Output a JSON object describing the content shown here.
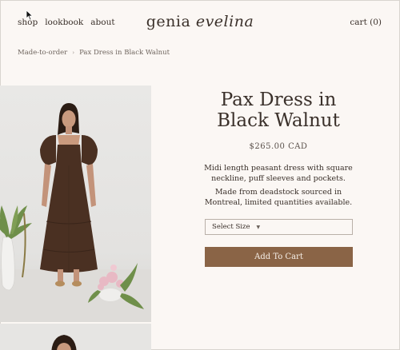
{
  "nav": {
    "items": [
      "shop",
      "lookbook",
      "about"
    ]
  },
  "brand": {
    "part1": "genia",
    "part2": "evelina"
  },
  "cart": {
    "label": "cart (0)"
  },
  "breadcrumb": {
    "parent": "Made-to-order",
    "separator": "›",
    "current": "Pax Dress in Black Walnut"
  },
  "product": {
    "title_line1": "Pax Dress in",
    "title_line2": "Black Walnut",
    "price": "$265.00 CAD",
    "description1": "Midi length peasant dress with square neckline, puff sleeves and pockets.",
    "description2": "Made from deadstock sourced in Montreal, limited quantities available.",
    "size_select": {
      "label": "Select Size",
      "caret": "▼"
    },
    "add_to_cart": "Add To Cart"
  },
  "colors": {
    "background": "#fbf7f4",
    "button": "#8a6446",
    "text": "#3a302a"
  }
}
